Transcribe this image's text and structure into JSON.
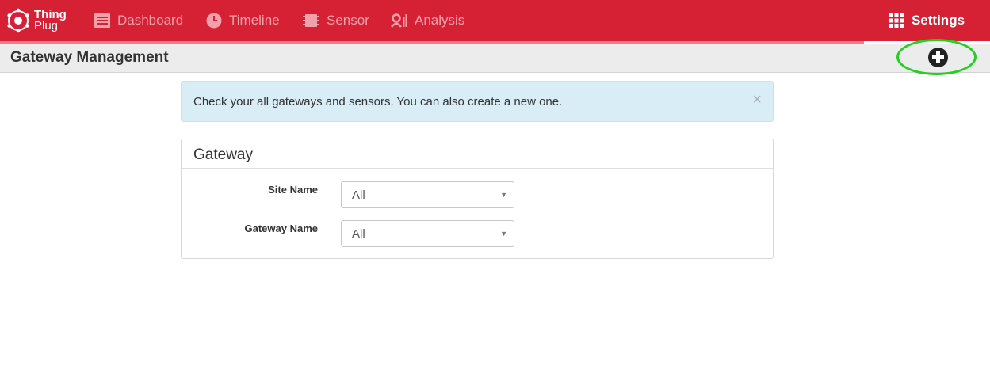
{
  "brand": {
    "line1": "Thing",
    "line2": "Plug"
  },
  "nav": {
    "items": [
      {
        "label": "Dashboard",
        "icon": "dashboard-icon"
      },
      {
        "label": "Timeline",
        "icon": "clock-icon"
      },
      {
        "label": "Sensor",
        "icon": "chip-icon"
      },
      {
        "label": "Analysis",
        "icon": "analysis-icon"
      }
    ],
    "active": {
      "label": "Settings",
      "icon": "grid-icon"
    }
  },
  "header": {
    "title": "Gateway Management",
    "add_icon": "plus-circle-icon"
  },
  "alert": {
    "text": "Check your all gateways and sensors. You can also create a new one.",
    "close": "×"
  },
  "panel": {
    "title": "Gateway",
    "fields": [
      {
        "label": "Site Name",
        "value": "All"
      },
      {
        "label": "Gateway Name",
        "value": "All"
      }
    ]
  },
  "colors": {
    "brand_red": "#d62034",
    "highlight": "#22d11e",
    "alert_bg": "#d9edf7"
  }
}
